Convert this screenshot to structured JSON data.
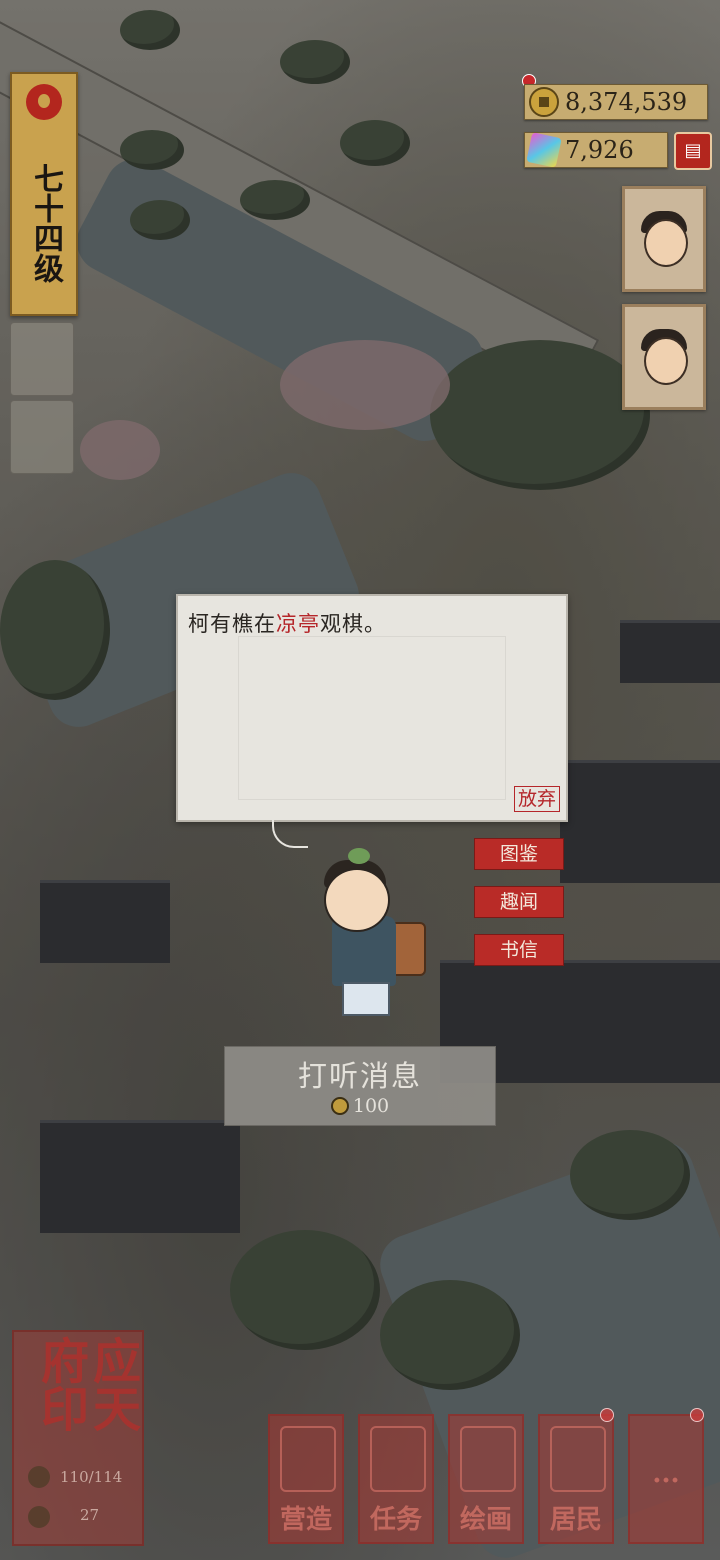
{
  "level": {
    "text": "七十四级"
  },
  "currency": {
    "coins": "8,374,539",
    "gems": "7,926"
  },
  "dialog": {
    "text_before": "柯有樵在",
    "text_highlight": "凉亭",
    "text_after": "观棋。",
    "abandon_label": "放弃"
  },
  "side_buttons": [
    "图鉴",
    "趣闻",
    "书信"
  ],
  "action": {
    "title": "打听消息",
    "cost": "100"
  },
  "city": {
    "name": "应天府印",
    "population": "110/114",
    "count": "27"
  },
  "nav": [
    "营造",
    "任务",
    "绘画",
    "居民",
    "···"
  ],
  "colors": {
    "accent_red": "#b92b27",
    "gold": "#c7ac71",
    "dialog_bg": "#e7e5df"
  }
}
